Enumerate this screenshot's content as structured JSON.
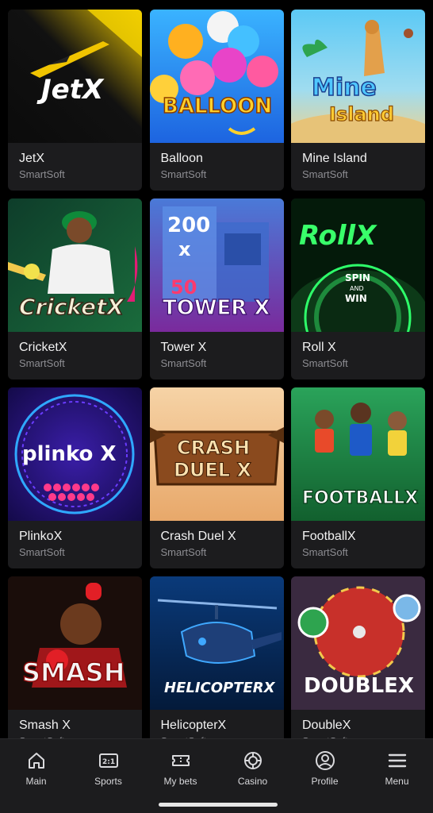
{
  "games": [
    {
      "title": "JetX",
      "provider": "SmartSoft",
      "art_text": "JetX"
    },
    {
      "title": "Balloon",
      "provider": "SmartSoft",
      "art_text": "BALLOON"
    },
    {
      "title": "Mine Island",
      "provider": "SmartSoft",
      "art_text": "Mine",
      "art_text2": "Island"
    },
    {
      "title": "CricketX",
      "provider": "SmartSoft",
      "art_text": "CricketX"
    },
    {
      "title": "Tower X",
      "provider": "SmartSoft",
      "art_text": "TOWER X",
      "art_num1": "200",
      "art_num2": "x",
      "art_num3": "50"
    },
    {
      "title": "Roll X",
      "provider": "SmartSoft",
      "art_text": "RollX",
      "art_text2": "SPIN",
      "art_text3": "AND",
      "art_text4": "WIN"
    },
    {
      "title": "PlinkoX",
      "provider": "SmartSoft",
      "art_text": "plinko X"
    },
    {
      "title": "Crash Duel X",
      "provider": "SmartSoft",
      "art_text": "CRASH",
      "art_text2": "DUEL X"
    },
    {
      "title": "FootballX",
      "provider": "SmartSoft",
      "art_text": "FOOTBALLX"
    },
    {
      "title": "Smash X",
      "provider": "SmartSoft",
      "art_text": "SMASH"
    },
    {
      "title": "HelicopterX",
      "provider": "SmartSoft",
      "art_text": "HELICOPTERX"
    },
    {
      "title": "DoubleX",
      "provider": "SmartSoft",
      "art_text": "DOUBLEX"
    }
  ],
  "nav": [
    {
      "label": "Main",
      "icon": "home-icon"
    },
    {
      "label": "Sports",
      "icon": "scoreboard-icon"
    },
    {
      "label": "My bets",
      "icon": "ticket-icon"
    },
    {
      "label": "Casino",
      "icon": "chip-icon"
    },
    {
      "label": "Profile",
      "icon": "user-icon"
    },
    {
      "label": "Menu",
      "icon": "hamburger-icon"
    }
  ],
  "nav_sports_icon_text": "2:1",
  "colors": {
    "background": "#000000",
    "card": "#1c1c1e",
    "nav": "#1c1c1e",
    "muted_text": "#8d8d92"
  }
}
